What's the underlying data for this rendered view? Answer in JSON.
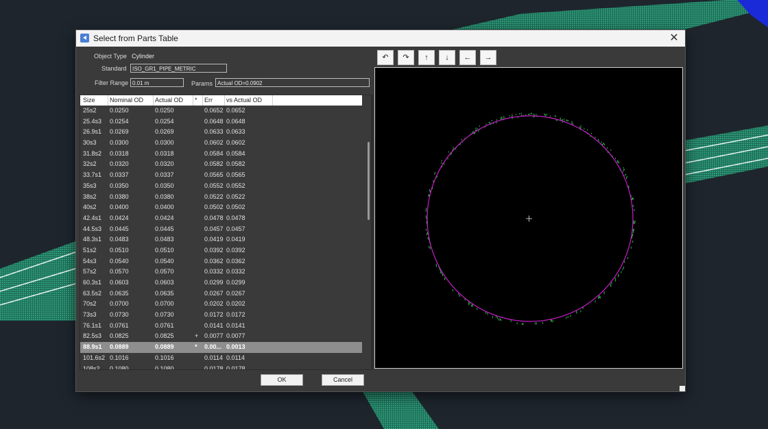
{
  "dialog": {
    "title": "Select from Parts Table"
  },
  "form": {
    "object_type_label": "Object Type",
    "object_type_value": "Cylinder",
    "standard_label": "Standard",
    "standard_value": "ISO_GR1_PIPE_METRIC",
    "filter_range_label": "Filter Range",
    "filter_range_value": "0.01 m",
    "params_label": "Params",
    "params_value": "Actual OD=0.0902"
  },
  "table": {
    "columns": [
      "Size",
      "Nominal OD",
      "Actual OD",
      "*",
      "Err",
      "vs Actual OD"
    ],
    "selected_index": 21,
    "rows": [
      [
        "25s2",
        "0.0250",
        "0.0250",
        "",
        "0.0652",
        "0.0652"
      ],
      [
        "25.4s3",
        "0.0254",
        "0.0254",
        "",
        "0.0648",
        "0.0648"
      ],
      [
        "26.9s1",
        "0.0269",
        "0.0269",
        "",
        "0.0633",
        "0.0633"
      ],
      [
        "30s3",
        "0.0300",
        "0.0300",
        "",
        "0.0602",
        "0.0602"
      ],
      [
        "31.8s2",
        "0.0318",
        "0.0318",
        "",
        "0.0584",
        "0.0584"
      ],
      [
        "32s2",
        "0.0320",
        "0.0320",
        "",
        "0.0582",
        "0.0582"
      ],
      [
        "33.7s1",
        "0.0337",
        "0.0337",
        "",
        "0.0565",
        "0.0565"
      ],
      [
        "35s3",
        "0.0350",
        "0.0350",
        "",
        "0.0552",
        "0.0552"
      ],
      [
        "38s2",
        "0.0380",
        "0.0380",
        "",
        "0.0522",
        "0.0522"
      ],
      [
        "40s2",
        "0.0400",
        "0.0400",
        "",
        "0.0502",
        "0.0502"
      ],
      [
        "42.4s1",
        "0.0424",
        "0.0424",
        "",
        "0.0478",
        "0.0478"
      ],
      [
        "44.5s3",
        "0.0445",
        "0.0445",
        "",
        "0.0457",
        "0.0457"
      ],
      [
        "48.3s1",
        "0.0483",
        "0.0483",
        "",
        "0.0419",
        "0.0419"
      ],
      [
        "51s2",
        "0.0510",
        "0.0510",
        "",
        "0.0392",
        "0.0392"
      ],
      [
        "54s3",
        "0.0540",
        "0.0540",
        "",
        "0.0362",
        "0.0362"
      ],
      [
        "57s2",
        "0.0570",
        "0.0570",
        "",
        "0.0332",
        "0.0332"
      ],
      [
        "60.3s1",
        "0.0603",
        "0.0603",
        "",
        "0.0299",
        "0.0299"
      ],
      [
        "63.5s2",
        "0.0635",
        "0.0635",
        "",
        "0.0267",
        "0.0267"
      ],
      [
        "70s2",
        "0.0700",
        "0.0700",
        "",
        "0.0202",
        "0.0202"
      ],
      [
        "73s3",
        "0.0730",
        "0.0730",
        "",
        "0.0172",
        "0.0172"
      ],
      [
        "76.1s1",
        "0.0761",
        "0.0761",
        "",
        "0.0141",
        "0.0141"
      ],
      [
        "82.5s3",
        "0.0825",
        "0.0825",
        "+",
        "0.0077",
        "0.0077"
      ],
      [
        "88.9s1",
        "0.0889",
        "0.0889",
        "*",
        "0.00...",
        "0.0013"
      ],
      [
        "101.6s2",
        "0.1016",
        "0.1016",
        "",
        "0.0114",
        "0.0114"
      ],
      [
        "108s2",
        "0.1080",
        "0.1080",
        "",
        "0.0178",
        "0.0178"
      ]
    ]
  },
  "toolbar": {
    "buttons": [
      {
        "icon": "rotate-ccw-icon",
        "glyph": "↶"
      },
      {
        "icon": "rotate-cw-icon",
        "glyph": "↷"
      },
      {
        "icon": "arrow-up-icon",
        "glyph": "↑"
      },
      {
        "icon": "arrow-down-icon",
        "glyph": "↓"
      },
      {
        "icon": "arrow-left-icon",
        "glyph": "←"
      },
      {
        "icon": "arrow-right-icon",
        "glyph": "→"
      }
    ]
  },
  "buttons": {
    "ok": "OK",
    "cancel": "Cancel"
  },
  "colors": {
    "circle": "#c81ec8",
    "points": "#2fae4a",
    "selected_row": "#8e8e8e"
  }
}
